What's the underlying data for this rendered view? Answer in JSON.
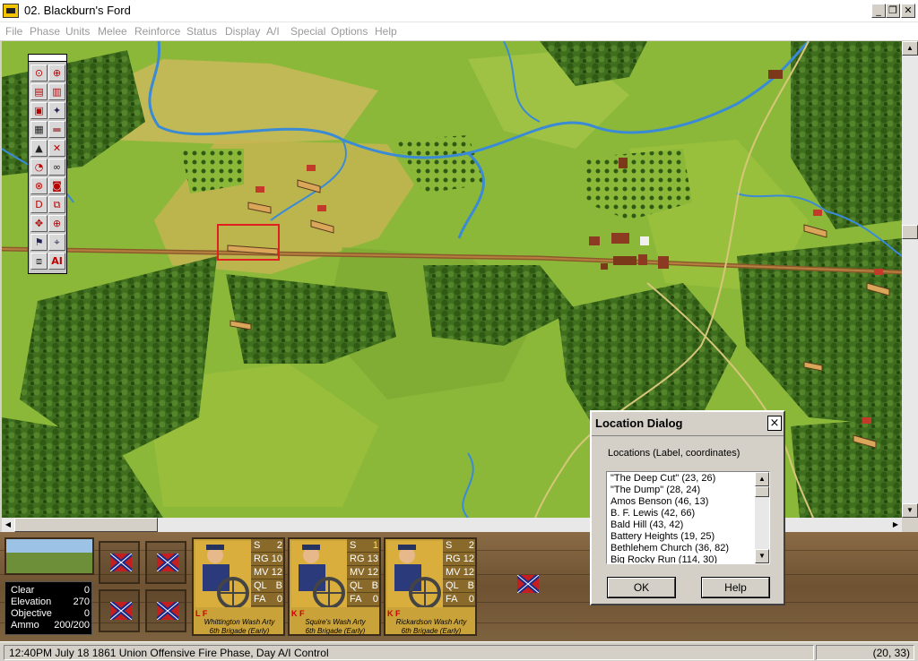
{
  "window": {
    "title": "02. Blackburn's Ford"
  },
  "menu": [
    "File",
    "Phase",
    "Units",
    "Melee",
    "Reinforce",
    "Status",
    "Display",
    "A/I",
    "Special",
    "Options",
    "Help"
  ],
  "toolbar_icons": [
    "binoculars-select-icon",
    "zoom-icon",
    "stack-up-icon",
    "stack-down-icon",
    "unit-info-icon",
    "infantry-icon",
    "fort-icon",
    "ammo-icon",
    "hex-outline-icon",
    "artillery-icon",
    "cavalry-icon",
    "spyglass-icon",
    "target-icon",
    "lock-icon",
    "defend-icon",
    "combine-icon",
    "move-icon",
    "fire-icon",
    "flag-icon",
    "map-icon",
    "leader-icon",
    "ai-icon"
  ],
  "terrain_info": {
    "rows": [
      {
        "label": "Clear",
        "value": "0"
      },
      {
        "label": "Elevation",
        "value": "270"
      },
      {
        "label": "Objective",
        "value": "0"
      },
      {
        "label": "Ammo",
        "value": "200/200"
      }
    ]
  },
  "units": [
    {
      "stats": [
        {
          "label": "S",
          "value": "2"
        },
        {
          "label": "RG",
          "value": "10"
        },
        {
          "label": "MV",
          "value": "12"
        },
        {
          "label": "QL",
          "value": "B"
        },
        {
          "label": "FA",
          "value": "0"
        }
      ],
      "flags": "L F",
      "name": "Whittington Wash Arty",
      "brigade": "6th Brigade (Early)"
    },
    {
      "stats": [
        {
          "label": "S",
          "value": "1"
        },
        {
          "label": "RG",
          "value": "13"
        },
        {
          "label": "MV",
          "value": "12"
        },
        {
          "label": "QL",
          "value": "B"
        },
        {
          "label": "FA",
          "value": "0"
        }
      ],
      "flags": "K F",
      "name": "Squire's Wash Arty",
      "brigade": "6th Brigade (Early)"
    },
    {
      "stats": [
        {
          "label": "S",
          "value": "2"
        },
        {
          "label": "RG",
          "value": "12"
        },
        {
          "label": "MV",
          "value": "12"
        },
        {
          "label": "QL",
          "value": "B"
        },
        {
          "label": "FA",
          "value": "0"
        }
      ],
      "flags": "K F",
      "name": "Rickardson Wash Arty",
      "brigade": "6th Brigade (Early)"
    }
  ],
  "dialog": {
    "title": "Location Dialog",
    "close": "×",
    "label": "Locations (Label, coordinates)",
    "items": [
      "\"The Deep Cut\" (23, 26)",
      "\"The Dump\" (28, 24)",
      "Amos Benson (46, 13)",
      "B. F. Lewis (42, 66)",
      "Bald Hill (43, 42)",
      "Battery Heights (19, 25)",
      "Bethlehem Church (36, 82)",
      "Big Rocky Run (114, 30)"
    ],
    "ok": "OK",
    "help": "Help"
  },
  "status": {
    "text": "12:40PM July 18 1861 Union Offensive Fire Phase, Day A/I Control",
    "coords": "(20, 33)"
  },
  "colors": {
    "grass": "#8cb83a",
    "ridge": "#c9b95a",
    "river": "#3a8ad6",
    "road": "#8b5a2b",
    "selection": "#e02020",
    "wood_panel": "#7a5c3a"
  }
}
